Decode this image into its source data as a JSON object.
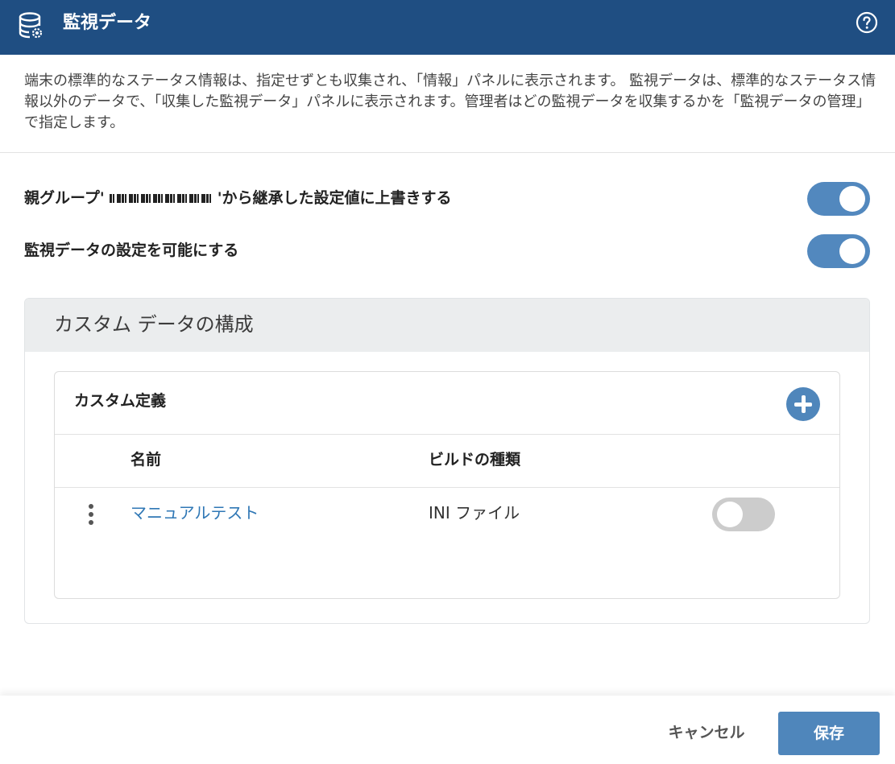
{
  "header": {
    "title": "監視データ",
    "icon": "database-gear-icon",
    "help_icon": "help-circle-icon",
    "background_color": "#1f4e82"
  },
  "description": "端末の標準的なステータス情報は、指定せずとも収集され、「情報」パネルに表示されます。 監視データは、標準的なステータス情報以外のデータで、「収集した監視データ」パネルに表示されます。管理者はどの監視データを収集するかを「監視データの管理」で指定します。",
  "settings": {
    "override": {
      "label_prefix": "親グループ'",
      "label_suffix": "'から継承した設定値に上書きする",
      "enabled": true
    },
    "enable_monitoring": {
      "label": "監視データの設定を可能にする",
      "enabled": true
    }
  },
  "custom_panel": {
    "title": "カスタム データの構成",
    "card": {
      "title": "カスタム定義",
      "add_icon": "plus-circle-icon",
      "columns": [
        "名前",
        "ビルドの種類"
      ],
      "rows": [
        {
          "name": "マニュアルテスト",
          "build_type": "INI ファイル",
          "enabled": false,
          "menu_icon": "kebab-menu-icon"
        }
      ]
    }
  },
  "footer": {
    "cancel_label": "キャンセル",
    "save_label": "保存"
  },
  "colors": {
    "accent": "#4f86bb",
    "toggle_on": "#5288be",
    "toggle_off": "#cccccc",
    "link": "#2f77b5"
  }
}
